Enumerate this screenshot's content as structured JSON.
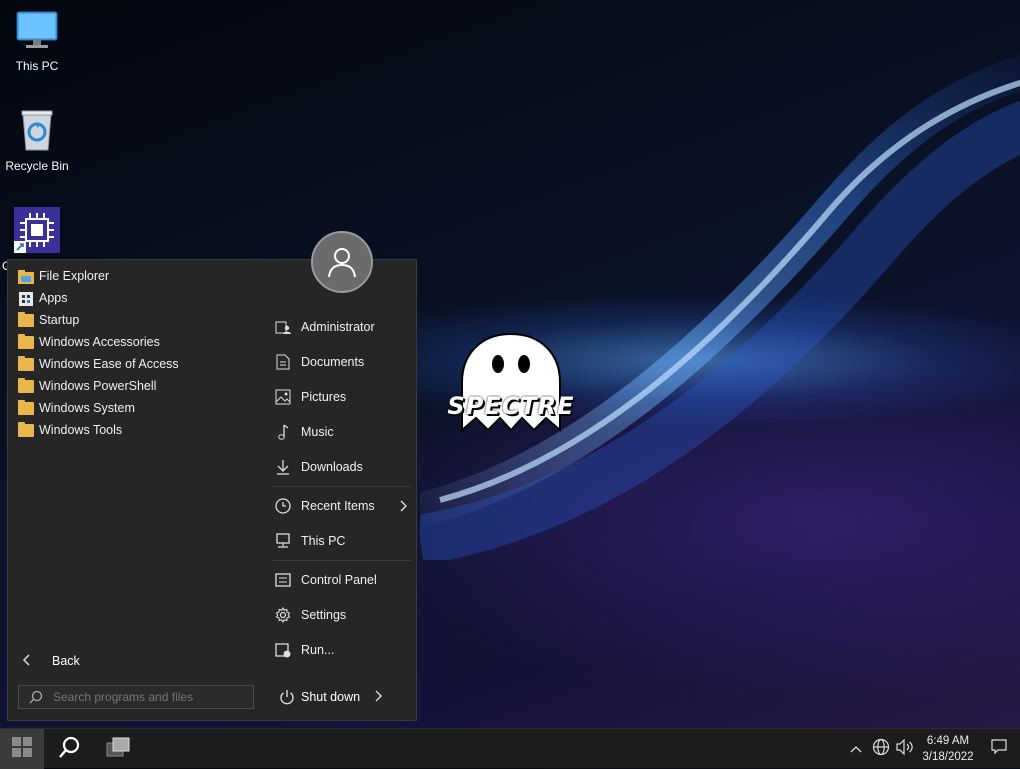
{
  "desktop": {
    "icons": [
      {
        "label": "This PC",
        "icon": "monitor-icon"
      },
      {
        "label": "Recycle Bin",
        "icon": "recycle-bin-icon"
      },
      {
        "label": "C",
        "icon": "cpu-chip-shortcut-icon"
      }
    ],
    "logo_text": "SPECTRE"
  },
  "start_menu": {
    "programs": [
      {
        "label": "File Explorer",
        "icon": "file-explorer-icon"
      },
      {
        "label": "Apps",
        "icon": "apps-icon"
      },
      {
        "label": "Startup",
        "icon": "folder-icon"
      },
      {
        "label": "Windows Accessories",
        "icon": "folder-icon"
      },
      {
        "label": "Windows Ease of Access",
        "icon": "folder-icon"
      },
      {
        "label": "Windows PowerShell",
        "icon": "folder-icon"
      },
      {
        "label": "Windows System",
        "icon": "folder-icon"
      },
      {
        "label": "Windows Tools",
        "icon": "folder-icon"
      }
    ],
    "back_label": "Back",
    "search_placeholder": "Search programs and files",
    "right_items": [
      {
        "label": "Administrator",
        "icon": "user-folder-icon"
      },
      {
        "label": "Documents",
        "icon": "document-icon"
      },
      {
        "label": "Pictures",
        "icon": "picture-icon"
      },
      {
        "label": "Music",
        "icon": "music-note-icon"
      },
      {
        "label": "Downloads",
        "icon": "download-arrow-icon"
      },
      {
        "label": "Recent Items",
        "icon": "clock-icon"
      },
      {
        "label": "This PC",
        "icon": "computer-icon"
      },
      {
        "label": "Control Panel",
        "icon": "control-panel-icon"
      },
      {
        "label": "Settings",
        "icon": "gear-icon"
      },
      {
        "label": "Run...",
        "icon": "run-icon"
      }
    ],
    "shutdown_label": "Shut down"
  },
  "taskbar": {
    "time": "6:49 AM",
    "date": "3/18/2022"
  },
  "colors": {
    "menu_bg": "#262626",
    "folder": "#e8b64a",
    "taskbar_bg": "#1c1c1c"
  }
}
